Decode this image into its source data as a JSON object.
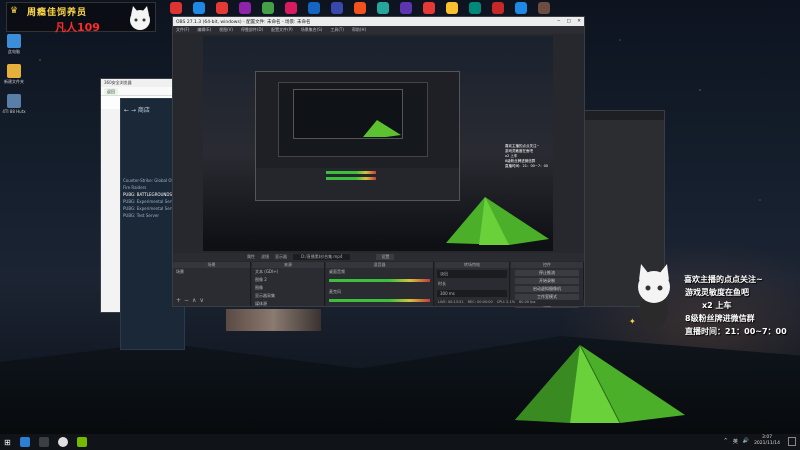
{
  "banner": {
    "title": "周瘾佳饲养员",
    "subtitle": "凡人109"
  },
  "desktop_icons": [
    {
      "label": "此电脑",
      "color": "#3d8ed8"
    },
    {
      "label": "新建文件夹",
      "color": "#e6b13a"
    },
    {
      "label": "4TI 88 Hutx",
      "color": "#5a7fa6"
    }
  ],
  "top_icons": [
    "#d33",
    "#1e88e5",
    "#e53935",
    "#8e24aa",
    "#43a047",
    "#d81b60",
    "#1565c0",
    "#3949ab",
    "#f4511e",
    "#26a69a",
    "#5e35b1",
    "#e53935",
    "#fbc02d",
    "#00897b",
    "#c62828",
    "#1e88e5",
    "#6d4c41"
  ],
  "obs": {
    "title": "OBS 27.1.3 (64-bit, windows) - 配置文件: 未命名 - 场景: 未命名",
    "menu": [
      "文件(F)",
      "编辑(E)",
      "视图(V)",
      "停靠部件(D)",
      "配置文件(P)",
      "场景集合(S)",
      "工具(T)",
      "帮助(H)"
    ],
    "ctrl_bar": {
      "label": "属性",
      "filter": "滤镜",
      "source": "显示器",
      "path": "D:/直播素材/合集.mp4",
      "btn": "设置"
    },
    "docks": {
      "scenes": {
        "header": "场景",
        "item": "场景"
      },
      "sources": {
        "header": "来源",
        "items": [
          "文本 (GDI+)",
          "图像 2",
          "图像",
          "显示器采集",
          "媒体源"
        ]
      },
      "mixer": {
        "header": "混音器",
        "tracks": [
          {
            "name": "桌面音频",
            "db": "0.0 dB"
          },
          {
            "name": "麦克风",
            "db": "0.0 dB"
          }
        ]
      },
      "transitions": {
        "header": "转场特效",
        "type": "淡出",
        "duration_label": "时长",
        "duration": "300 ms"
      },
      "controls": {
        "header": "控件",
        "buttons": [
          "停止推流",
          "开始录制",
          "启动虚拟摄像机",
          "工作室模式",
          "设置",
          "退出"
        ]
      }
    },
    "status": {
      "live": "LIVE: 00:13:51",
      "rec": "REC: 00:00:00",
      "cpu": "CPU: 2.1%",
      "fps": "60.00 fps"
    }
  },
  "browser": {
    "title": "360安全浏览器",
    "back": "返回"
  },
  "steam": {
    "nav": "← → 商店",
    "list": [
      "Counter-Strike: Global Offensive",
      "Fire Raiders",
      "PUBG: BATTLEGROUNDS",
      "PUBG: Experimental Server",
      "PUBG: Experimental Server",
      "PUBG: Test Server"
    ]
  },
  "dark_win": {
    "title": ""
  },
  "overlay": {
    "lines": [
      "喜欢主播的点点关注~",
      "游戏灵敏度在鱼吧",
      "x2 上车",
      "8级粉丝牌进微信群",
      "直播时间：21：00~7：00"
    ]
  },
  "taskbar": {
    "icons": [
      "#2b80d6",
      "#3c3f44",
      "#e0e0e0",
      "#76b900"
    ],
    "time": "3:07",
    "date": "2021/11/14",
    "tray": [
      "^",
      "英",
      "🔊"
    ]
  }
}
